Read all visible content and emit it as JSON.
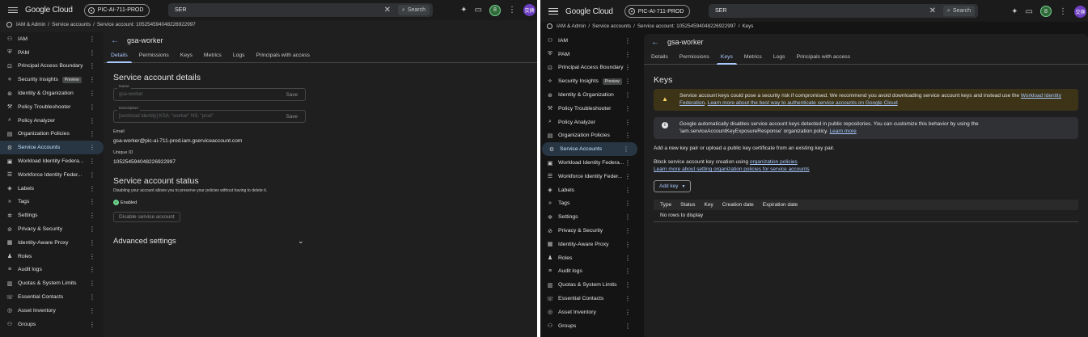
{
  "topbar": {
    "brand": "Google Cloud",
    "project": "PIC-AI-711-PROD",
    "search_value": "SER",
    "search_button": "Search",
    "user_initial": "8",
    "avatar_text": "交换"
  },
  "left": {
    "breadcrumbs": [
      "IAM & Admin",
      "Service accounts",
      "Service account: 105254594048226922997"
    ],
    "sidebar": [
      {
        "icon": "people-icon",
        "glyph": "⚇",
        "label": "IAM"
      },
      {
        "icon": "shield-icon",
        "glyph": "⛨",
        "label": "PAM"
      },
      {
        "icon": "boundary-icon",
        "glyph": "⊡",
        "label": "Principal Access Boundary"
      },
      {
        "icon": "insights-icon",
        "glyph": "⟡",
        "label": "Security Insights",
        "badge": "Preview"
      },
      {
        "icon": "identity-icon",
        "glyph": "⊛",
        "label": "Identity & Organization"
      },
      {
        "icon": "wrench-icon",
        "glyph": "⚒",
        "label": "Policy Troubleshooter"
      },
      {
        "icon": "analyzer-icon",
        "glyph": "⌕",
        "label": "Policy Analyzer"
      },
      {
        "icon": "org-policy-icon",
        "glyph": "▤",
        "label": "Organization Policies"
      },
      {
        "icon": "service-account-icon",
        "glyph": "⚙",
        "label": "Service Accounts",
        "active": true
      },
      {
        "icon": "workload-identity-icon",
        "glyph": "▣",
        "label": "Workload Identity Federa..."
      },
      {
        "icon": "workforce-identity-icon",
        "glyph": "☰",
        "label": "Workforce Identity Feder..."
      },
      {
        "icon": "label-icon",
        "glyph": "◈",
        "label": "Labels"
      },
      {
        "icon": "tag-icon",
        "glyph": "»",
        "label": "Tags"
      },
      {
        "icon": "settings-icon",
        "glyph": "✲",
        "label": "Settings"
      },
      {
        "icon": "privacy-icon",
        "glyph": "⊘",
        "label": "Privacy & Security"
      },
      {
        "icon": "iap-icon",
        "glyph": "▦",
        "label": "Identity-Aware Proxy"
      },
      {
        "icon": "roles-icon",
        "glyph": "♟",
        "label": "Roles"
      },
      {
        "icon": "audit-logs-icon",
        "glyph": "≡",
        "label": "Audit logs"
      },
      {
        "icon": "quotas-icon",
        "glyph": "▥",
        "label": "Quotas & System Limits"
      },
      {
        "icon": "contacts-icon",
        "glyph": "☏",
        "label": "Essential Contacts"
      },
      {
        "icon": "inventory-icon",
        "glyph": "◎",
        "label": "Asset Inventory"
      },
      {
        "icon": "groups-icon",
        "glyph": "⚇",
        "label": "Groups"
      }
    ],
    "title": "gsa-worker",
    "tabs": [
      "Details",
      "Permissions",
      "Keys",
      "Metrics",
      "Logs",
      "Principals with access"
    ],
    "active_tab": 0,
    "details": {
      "heading": "Service account details",
      "name_label": "Name",
      "name_value": "gsa-worker",
      "save_label": "Save",
      "description_label": "Description",
      "description_value": "[workload identity] KSA: \"worker\" NS: \"prod\"",
      "email_label": "Email",
      "email_value": "gsa-worker@pic-ai-711-prod.iam.gserviceaccount.com",
      "uid_label": "Unique ID",
      "uid_value": "105254594048226922997",
      "status_heading": "Service account status",
      "status_desc": "Disabling your account allows you to preserve your policies without having to delete it.",
      "status_value": "Enabled",
      "disable_button": "Disable service account",
      "advanced_heading": "Advanced settings"
    }
  },
  "right": {
    "breadcrumbs": [
      "IAM & Admin",
      "Service accounts",
      "Service account: 105254594048226922997",
      "Keys"
    ],
    "sidebar": [
      {
        "icon": "people-icon",
        "glyph": "⚇",
        "label": "IAM"
      },
      {
        "icon": "shield-icon",
        "glyph": "⛨",
        "label": "PAM"
      },
      {
        "icon": "boundary-icon",
        "glyph": "⊡",
        "label": "Principal Access Boundary"
      },
      {
        "icon": "insights-icon",
        "glyph": "⟡",
        "label": "Security Insights",
        "badge": "Preview"
      },
      {
        "icon": "identity-icon",
        "glyph": "⊛",
        "label": "Identity & Organization"
      },
      {
        "icon": "wrench-icon",
        "glyph": "⚒",
        "label": "Policy Troubleshooter"
      },
      {
        "icon": "analyzer-icon",
        "glyph": "⌕",
        "label": "Policy Analyzer"
      },
      {
        "icon": "org-policy-icon",
        "glyph": "▤",
        "label": "Organization Policies"
      },
      {
        "icon": "service-account-icon",
        "glyph": "⚙",
        "label": "Service Accounts",
        "active": true
      },
      {
        "icon": "workload-identity-icon",
        "glyph": "▣",
        "label": "Workload Identity Federa..."
      },
      {
        "icon": "workforce-identity-icon",
        "glyph": "☰",
        "label": "Workforce Identity Feder..."
      },
      {
        "icon": "label-icon",
        "glyph": "◈",
        "label": "Labels"
      },
      {
        "icon": "tag-icon",
        "glyph": "»",
        "label": "Tags"
      },
      {
        "icon": "settings-icon",
        "glyph": "✲",
        "label": "Settings"
      },
      {
        "icon": "privacy-icon",
        "glyph": "⊘",
        "label": "Privacy & Security"
      },
      {
        "icon": "iap-icon",
        "glyph": "▦",
        "label": "Identity-Aware Proxy"
      },
      {
        "icon": "roles-icon",
        "glyph": "♟",
        "label": "Roles"
      },
      {
        "icon": "audit-logs-icon",
        "glyph": "≡",
        "label": "Audit logs"
      },
      {
        "icon": "quotas-icon",
        "glyph": "▥",
        "label": "Quotas & System Limits"
      },
      {
        "icon": "contacts-icon",
        "glyph": "☏",
        "label": "Essential Contacts"
      },
      {
        "icon": "inventory-icon",
        "glyph": "◎",
        "label": "Asset Inventory"
      },
      {
        "icon": "groups-icon",
        "glyph": "⚇",
        "label": "Groups"
      }
    ],
    "title": "gsa-worker",
    "tabs": [
      "Details",
      "Permissions",
      "Keys",
      "Metrics",
      "Logs",
      "Principals with access"
    ],
    "active_tab": 2,
    "keys": {
      "heading": "Keys",
      "warning_text": "Service account keys could pose a security risk if compromised. We recommend you avoid downloading service account keys and instead use the ",
      "warning_link1": "Workload Identity Federation",
      "warning_mid": ". ",
      "warning_link2": "Learn more about the best way to authenticate service accounts on Google Cloud",
      "info_text": "Google automatically disables service account keys detected in public repositories. You can customize this behavior by using the 'iam.serviceAccountKeyExposureResponse' organization policy. ",
      "info_link": "Learn more",
      "add_desc": "Add a new key pair or upload a public key certificate from an existing key pair.",
      "block_text": "Block service account key creation using ",
      "block_link": "organization policies",
      "learn_org_link": "Learn more about setting organization policies for service accounts",
      "add_key_button": "Add key",
      "table_headers": [
        "Type",
        "Status",
        "Key",
        "Creation date",
        "Expiration date"
      ],
      "empty_text": "No rows to display"
    }
  },
  "colors": {
    "accent": "#a8c7fa",
    "warning_bg": "#3d3418",
    "warning_icon": "#fdd663",
    "info_bg": "#303134",
    "enabled_green": "#6dd58c"
  }
}
